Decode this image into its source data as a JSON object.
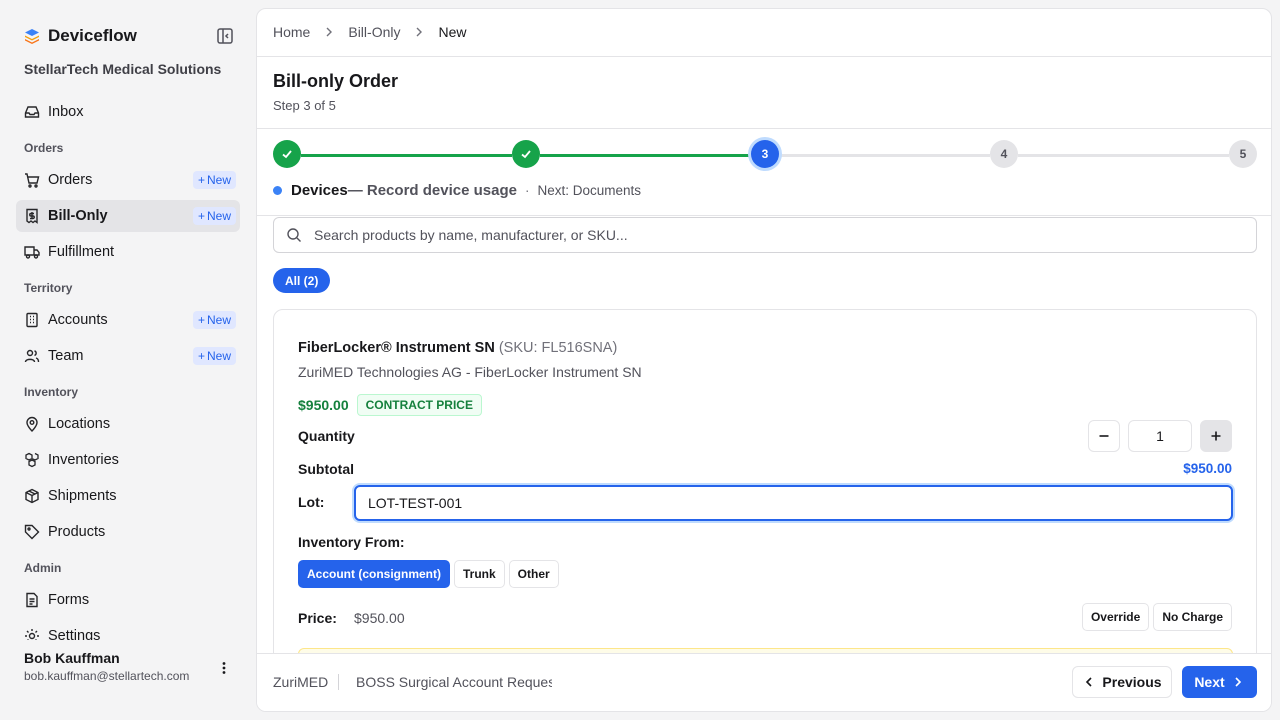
{
  "app": {
    "name": "Deviceflow",
    "org": "StellarTech Medical Solutions"
  },
  "sidebar": {
    "new_label": "New",
    "items": [
      {
        "label": "Inbox",
        "icon": "inbox-icon"
      },
      {
        "label": "Orders",
        "icon": "cart-icon",
        "has_new": true
      },
      {
        "label": "Bill-Only",
        "icon": "receipt-icon",
        "has_new": true,
        "active": true
      },
      {
        "label": "Fulfillment",
        "icon": "truck-icon"
      },
      {
        "label": "Accounts",
        "icon": "building-icon",
        "has_new": true
      },
      {
        "label": "Team",
        "icon": "users-icon",
        "has_new": true
      },
      {
        "label": "Locations",
        "icon": "map-pin-icon"
      },
      {
        "label": "Inventories",
        "icon": "boxes-icon"
      },
      {
        "label": "Shipments",
        "icon": "package-icon"
      },
      {
        "label": "Products",
        "icon": "tag-icon"
      },
      {
        "label": "Forms",
        "icon": "file-text-icon"
      },
      {
        "label": "Settings",
        "icon": "settings-icon"
      }
    ],
    "sections": [
      "Orders",
      "Territory",
      "Inventory",
      "Admin"
    ],
    "user": {
      "name": "Bob Kauffman",
      "email": "bob.kauffman@stellartech.com"
    }
  },
  "breadcrumb": [
    "Home",
    "Bill-Only",
    "New"
  ],
  "page": {
    "title": "Bill-only Order",
    "step_text": "Step 3 of 5"
  },
  "stepper": {
    "steps": [
      {
        "label": "1",
        "state": "done"
      },
      {
        "label": "2",
        "state": "done"
      },
      {
        "label": "3",
        "state": "current"
      },
      {
        "label": "4",
        "state": "todo"
      },
      {
        "label": "5",
        "state": "todo"
      }
    ],
    "current_name": "Devices",
    "current_desc": "— Record device usage",
    "separator": "·",
    "next_text": "Next: Documents"
  },
  "search": {
    "placeholder": "Search products by name, manufacturer, or SKU...",
    "value": ""
  },
  "filter": {
    "label": "All (2)"
  },
  "product": {
    "name": "FiberLocker® Instrument SN",
    "sku": "(SKU: FL516SNA)",
    "manufacturer": "ZuriMED Technologies AG - FiberLocker Instrument SN",
    "price": "$950.00",
    "price_badge": "CONTRACT PRICE",
    "quantity_label": "Quantity",
    "quantity": "1",
    "subtotal_label": "Subtotal",
    "subtotal": "$950.00",
    "lot_label": "Lot:",
    "lot_value": "LOT-TEST-001",
    "inventory_label": "Inventory From:",
    "inventory_options": [
      "Account (consignment)",
      "Trunk",
      "Other"
    ],
    "inventory_selected": "Account (consignment)",
    "price_label": "Price:",
    "price_value": "$950.00",
    "override_label": "Override",
    "no_charge_label": "No Charge"
  },
  "footer": {
    "vendor": "ZuriMED",
    "account": "BOSS Surgical Account Request",
    "prev_label": "Previous",
    "next_label": "Next"
  },
  "colors": {
    "accent": "#2563eb",
    "success": "#16a34a",
    "price_green": "#15803d"
  }
}
